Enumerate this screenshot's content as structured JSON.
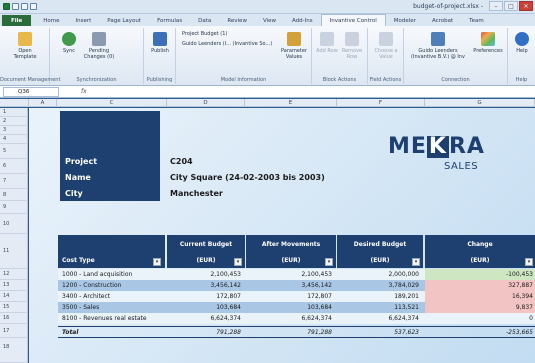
{
  "window": {
    "title": "budget-of-project.xlsx -"
  },
  "controls": {
    "minimize": "–",
    "maximize": "□",
    "close": "✕"
  },
  "tabs": [
    "File",
    "Home",
    "Insert",
    "Page Layout",
    "Formulas",
    "Data",
    "Review",
    "View",
    "Add-Ins",
    "Invantive Control",
    "Modeler",
    "Acrobat",
    "Team"
  ],
  "active_tab": "Invantive Control",
  "ribbon": {
    "open_template": "Open Template",
    "sync": "Sync",
    "pending": "Pending Changes (0)",
    "publish": "Publish",
    "model_line1": "Project Budget (1)",
    "model_line2": "Guido Leenders (I... (Invantive So...)",
    "parameter": "Parameter Values",
    "add_row": "Add Row",
    "remove_row": "Remove Row",
    "choose_value": "Choose a Value",
    "connection": "Guido Leenders (Invantive B.V.) @ Inv",
    "preferences": "Preferences",
    "help": "Help",
    "groups": [
      "Document Management",
      "Synchronization",
      "Publishing",
      "Model Information",
      "Block Actions",
      "Field Actions",
      "Connection",
      "Help"
    ]
  },
  "formula_bar": {
    "cell_ref": "Q36",
    "fx": "fx"
  },
  "columns": [
    "A",
    "C",
    "D",
    "E",
    "F",
    "G"
  ],
  "rows": [
    "1",
    "2",
    "3",
    "4",
    "5",
    "6",
    "7",
    "8",
    "9",
    "10",
    "11",
    "12",
    "13",
    "14",
    "15",
    "16",
    "17",
    "18"
  ],
  "project": {
    "labels": [
      "Project",
      "Name",
      "City"
    ],
    "values": [
      "C204",
      "City Square (24-02-2003 bis 2003)",
      "Manchester"
    ]
  },
  "logo": {
    "text_left": "ME",
    "text_k": "K",
    "text_right": "RA",
    "sub": "SALES"
  },
  "table": {
    "headers": [
      {
        "line1": "",
        "line2": "Cost Type"
      },
      {
        "line1": "Current Budget",
        "line2": "(EUR)"
      },
      {
        "line1": "After Movements",
        "line2": "(EUR)"
      },
      {
        "line1": "Desired Budget",
        "line2": "(EUR)"
      },
      {
        "line1": "Change",
        "line2": "(EUR)"
      }
    ],
    "rows": [
      {
        "type": "1000 - Land acquisition",
        "current": "2,100,453",
        "after": "2,100,453",
        "desired": "2,000,000",
        "change": "-100,453"
      },
      {
        "type": "1200 - Construction",
        "current": "3,456,142",
        "after": "3,456,142",
        "desired": "3,784,029",
        "change": "327,887"
      },
      {
        "type": "3400 - Architect",
        "current": "172,807",
        "after": "172,807",
        "desired": "189,201",
        "change": "16,394"
      },
      {
        "type": "3500 - Sales",
        "current": "103,684",
        "after": "103,684",
        "desired": "113,521",
        "change": "9,837"
      },
      {
        "type": "8100 - Revenues real estate",
        "current": "6,624,374",
        "after": "6,624,374",
        "desired": "6,624,374",
        "change": "0"
      }
    ],
    "total": {
      "type": "Total",
      "current": "791,288",
      "after": "791,288",
      "desired": "537,623",
      "change": "-253,665"
    }
  },
  "colors": {
    "navy": "#1e4070",
    "file_tab": "#2a6d3b",
    "green_cell": "#cfe6c3",
    "red_cell": "#f3c4c4",
    "row_alt": "#a9c7e5"
  }
}
